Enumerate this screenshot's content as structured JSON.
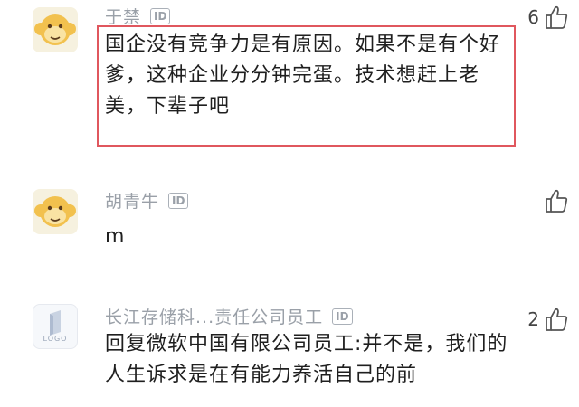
{
  "comments": [
    {
      "username": "于禁",
      "badge": "ID",
      "text": "国企没有竞争力是有原因。如果不是有个好爹，这种企业分分钟完蛋。技术想赶上老美，下辈子吧",
      "likes": "6",
      "avatar": "monkey-icon",
      "highlighted": true,
      "highlight_color": "#e0575e"
    },
    {
      "username": "胡青牛",
      "badge": "ID",
      "text": "m",
      "likes": "",
      "avatar": "monkey-icon"
    },
    {
      "username": "长江存储科...责任公司员工",
      "badge": "ID",
      "text": "回复微软中国有限公司员工:并不是，我们的人生诉求是在有能力养活自己的前",
      "likes": "2",
      "avatar": "logo-icon",
      "avatar_text": "LOGO"
    }
  ],
  "colors": {
    "username": "#9aa0a8",
    "text": "#1f1f1f",
    "monkey": "#f2c14e"
  }
}
